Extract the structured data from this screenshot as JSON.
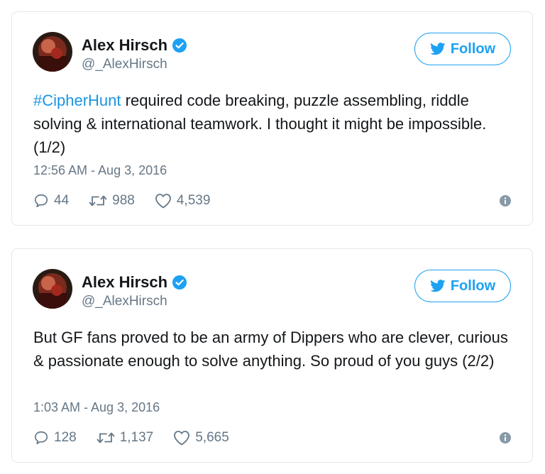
{
  "colors": {
    "accent": "#1da1f2",
    "hashtag": "#1b95e0",
    "secondary_text": "#657786",
    "border": "#e1e8ed"
  },
  "tweets": [
    {
      "author_name": "Alex Hirsch",
      "handle": "@_AlexHirsch",
      "follow_label": "Follow",
      "hashtag": "#CipherHunt",
      "text": " required code breaking, puzzle assembling, riddle solving & international teamwork. I thought it might be impossible. (1/2)",
      "timestamp": "12:56 AM - Aug 3, 2016",
      "replies": "44",
      "retweets": "988",
      "likes": "4,539",
      "icons": [
        "verified-badge-icon",
        "twitter-bird-icon",
        "reply-icon",
        "retweet-icon",
        "heart-icon",
        "info-icon"
      ]
    },
    {
      "author_name": "Alex Hirsch",
      "handle": "@_AlexHirsch",
      "follow_label": "Follow",
      "hashtag": "",
      "text": "But GF fans proved to be an army of Dippers who are clever, curious & passionate enough to solve anything. So proud of you guys (2/2)",
      "timestamp": "1:03 AM - Aug 3, 2016",
      "replies": "128",
      "retweets": "1,137",
      "likes": "5,665",
      "icons": [
        "verified-badge-icon",
        "twitter-bird-icon",
        "reply-icon",
        "retweet-icon",
        "heart-icon",
        "info-icon"
      ]
    }
  ]
}
